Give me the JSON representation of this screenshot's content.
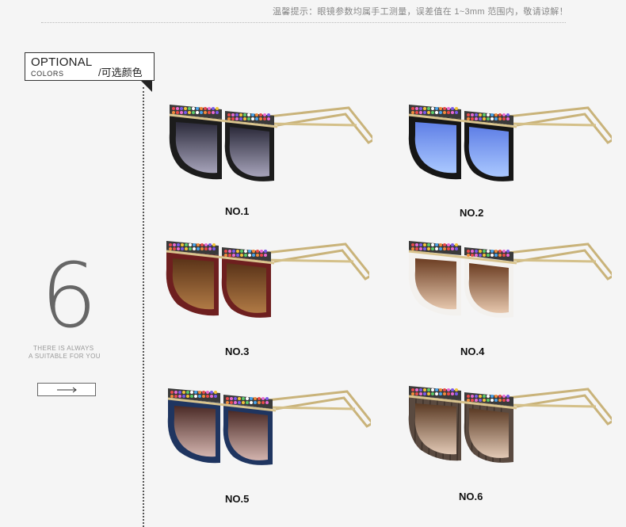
{
  "notice": "温馨提示：眼镜参数均属手工测量，误差值在 1~3mm 范围内，敬请谅解！",
  "options": {
    "title": "OPTIONAL",
    "subtitle": "COLORS",
    "chinese": "/可选颜色"
  },
  "side": {
    "number": "6",
    "tagline_1": "THERE IS ALWAYS",
    "tagline_2": "A SUITABLE FOR YOU",
    "arrow_icon": "right-arrow-icon"
  },
  "products": [
    {
      "label": "NO.1",
      "frame": "#1c1c1c",
      "lens_top": "#2b2a3a",
      "lens_bottom": "#a6a3ba",
      "pattern": "solid"
    },
    {
      "label": "NO.2",
      "frame": "#161616",
      "lens_top": "#5f7fe6",
      "lens_bottom": "#aac8ff",
      "pattern": "solid"
    },
    {
      "label": "NO.3",
      "frame": "#6e1f1f",
      "lens_top": "#5a3318",
      "lens_bottom": "#b07a45",
      "pattern": "solid"
    },
    {
      "label": "NO.4",
      "frame": "#f3f1ee",
      "lens_top": "#6b3d22",
      "lens_bottom": "#e6c7ad",
      "pattern": "solid"
    },
    {
      "label": "NO.5",
      "frame": "#1f3560",
      "lens_top": "#4a2a26",
      "lens_bottom": "#d3b4ae",
      "pattern": "solid"
    },
    {
      "label": "NO.6",
      "frame": "#5a4a40",
      "lens_top": "#5a3a24",
      "lens_bottom": "#e2c9b5",
      "pattern": "wood"
    }
  ]
}
